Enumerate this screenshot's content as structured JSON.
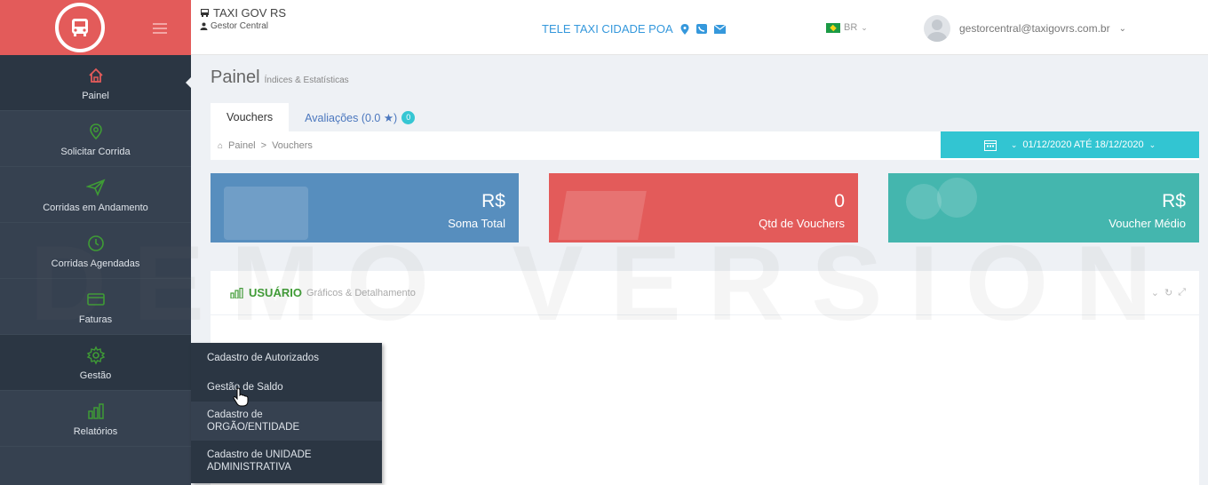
{
  "header": {
    "app_title": "TAXI GOV RS",
    "role": "Gestor Central",
    "company": "TELE TAXI CIDADE POA",
    "language": "BR",
    "user_email": "gestorcentral@taxigovrs.com.br"
  },
  "sidebar": {
    "items": [
      {
        "label": "Painel",
        "icon": "home-icon"
      },
      {
        "label": "Solicitar Corrida",
        "icon": "map-pin-icon"
      },
      {
        "label": "Corridas em Andamento",
        "icon": "send-icon"
      },
      {
        "label": "Corridas Agendadas",
        "icon": "clock-icon"
      },
      {
        "label": "Faturas",
        "icon": "credit-card-icon"
      },
      {
        "label": "Gestão",
        "icon": "gear-icon"
      },
      {
        "label": "Relatórios",
        "icon": "bar-chart-icon"
      }
    ],
    "submenu": [
      "Cadastro de Autorizados",
      "Gestão de Saldo",
      "Cadastro de ORGÃO/ENTIDADE",
      "Cadastro de UNIDADE ADMINISTRATIVA"
    ]
  },
  "page": {
    "title": "Painel",
    "subtitle": "Índices & Estatísticas",
    "tabs": [
      "Vouchers",
      "Avaliações (0.0 ★)"
    ],
    "tab_badge": "0",
    "breadcrumb": [
      "Painel",
      "Vouchers"
    ],
    "date_range": "01/12/2020 ATÉ 18/12/2020"
  },
  "stats": [
    {
      "value": "R$",
      "label": "Soma Total",
      "color": "#578ebe"
    },
    {
      "value": "0",
      "label": "Qtd de Vouchers",
      "color": "#e35b5a"
    },
    {
      "value": "R$",
      "label": "Voucher Médio",
      "color": "#44b6ae"
    }
  ],
  "portlet": {
    "title": "USUÁRIO",
    "subtitle": "Gráficos & Detalhamento"
  },
  "watermark": "DEMO VERSION"
}
